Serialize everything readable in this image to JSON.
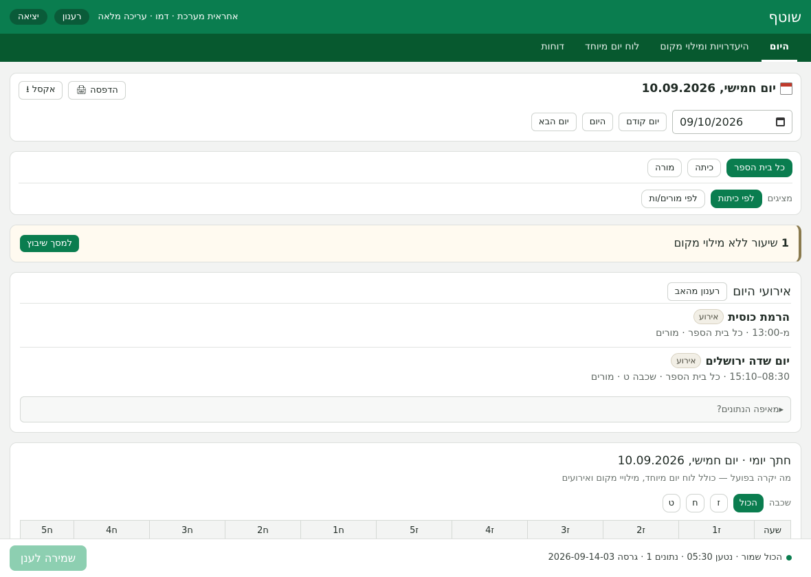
{
  "app": {
    "brand": "שוטף",
    "user_info": "אחראית מערכת · דמו · עריכה מלאה",
    "refresh_label": "רענון",
    "logout_label": "יציאה"
  },
  "nav": [
    {
      "label": "היום",
      "active": true
    },
    {
      "label": "היעדרויות ומילוי מקום"
    },
    {
      "label": "לוח יום מיוחד"
    },
    {
      "label": "דוחות"
    }
  ],
  "date_card": {
    "title": "יום חמישי, 10.09.2026",
    "print_label": "🖨 הדפסה",
    "excel_label": "⭳ אקסל",
    "date_value": "09/10/2026",
    "prev_label": "יום קודם",
    "today_label": "היום",
    "next_label": "יום הבא"
  },
  "filters": {
    "scope": [
      {
        "label": "כל בית הספר",
        "active": true
      },
      {
        "label": "כיתה"
      },
      {
        "label": "מורה"
      }
    ],
    "view_label": "מציגים",
    "view": [
      {
        "label": "לפי כיתות",
        "active": true
      },
      {
        "label": "לפי מורים/ות"
      }
    ]
  },
  "alert": {
    "count": "1",
    "text": "שיעור ללא מילוי מקום",
    "button": "למסך שיבוץ"
  },
  "events": {
    "title": "אירועי היום",
    "refresh_label": "רענון מהאב",
    "items": [
      {
        "badge": "אירוע",
        "name": "הרמת כוסית",
        "meta": "מ-13:00 · כל בית הספר · מורים"
      },
      {
        "badge": "אירוע",
        "name": "יום שדה ירושלים",
        "meta": "08:30–15:10 · כל בית הספר · שכבה ט · מורים"
      }
    ],
    "data_source": "▸מאיפה הנתונים?"
  },
  "daily": {
    "title": "חתך יומי · יום חמישי, 10.09.2026",
    "subtitle": "מה יקרה בפועל — כולל לוח יום מיוחד, מילויי מקום ואירועים",
    "grade_label": "שכבה",
    "grades": [
      {
        "label": "הכול",
        "active": true
      },
      {
        "label": "ז"
      },
      {
        "label": "ח"
      },
      {
        "label": "ט"
      }
    ],
    "columns": [
      "שעה",
      "ז1",
      "ז2",
      "ז3",
      "ז4",
      "ז5",
      "ח1",
      "ח2",
      "ח3",
      "ח4",
      "ח5"
    ]
  },
  "footer": {
    "status": "הכול שמור · נטען 05:30 · נתונים 1 · גרסה 2026-09-14-03",
    "save_label": "שמירה לענן"
  },
  "colors": {
    "primary": "#0a7d4f",
    "nav": "#07592f",
    "alert_bg": "#fffaf0"
  }
}
